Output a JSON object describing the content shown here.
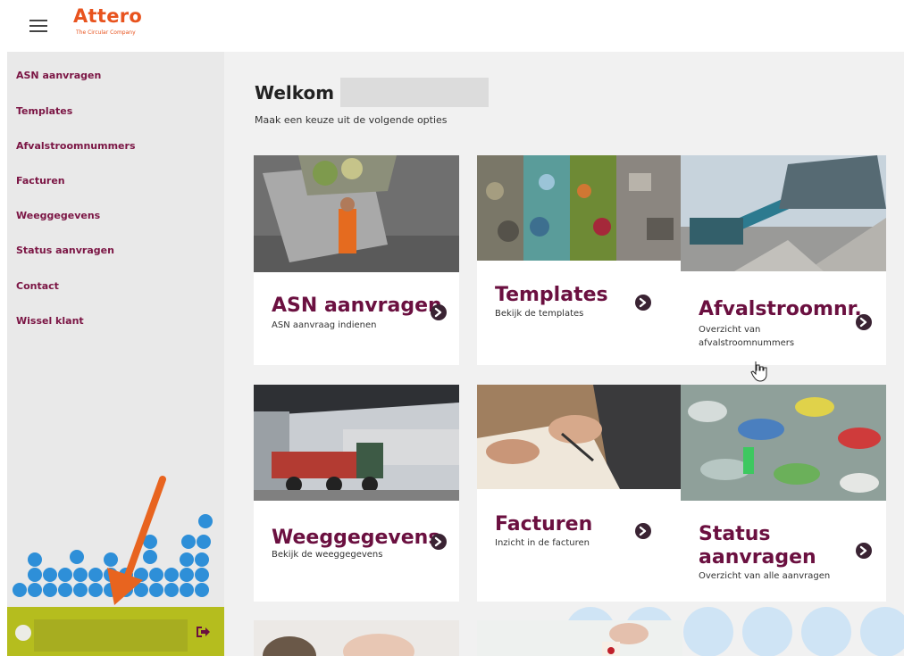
{
  "header": {
    "logo_text": "Attero",
    "logo_tagline": "The Circular Company"
  },
  "sidebar": {
    "items": [
      {
        "label": "ASN aanvragen"
      },
      {
        "label": "Templates"
      },
      {
        "label": "Afvalstroomnummers"
      },
      {
        "label": "Facturen"
      },
      {
        "label": "Weeggegevens"
      },
      {
        "label": "Status aanvragen"
      },
      {
        "label": "Contact"
      },
      {
        "label": "Wissel klant"
      }
    ]
  },
  "main": {
    "welcome": "Welkom",
    "subtitle": "Maak een keuze uit de volgende opties",
    "cards": [
      {
        "title": "ASN aanvragen",
        "desc": "ASN aanvraag indienen"
      },
      {
        "title": "Templates",
        "desc": "Bekijk de templates"
      },
      {
        "title": "Afvalstroomnr.",
        "desc": "Overzicht van afvalstroomnummers"
      },
      {
        "title": "Weeggegevens",
        "desc": "Bekijk de weeggegevens"
      },
      {
        "title": "Facturen",
        "desc": "Inzicht in de facturen"
      },
      {
        "title_line1": "Status",
        "title_line2": "aanvragen",
        "desc": "Overzicht van alle aanvragen"
      }
    ]
  },
  "colors": {
    "brand_orange": "#e8531e",
    "nav_text": "#7b1544",
    "card_title": "#6b1040",
    "userbar": "#b5bd1e",
    "dot_blue": "#2e8fd8"
  },
  "icons": {
    "menu": "hamburger-icon",
    "logout": "logout-icon",
    "card_arrow": "arrow-circle-right-icon"
  }
}
